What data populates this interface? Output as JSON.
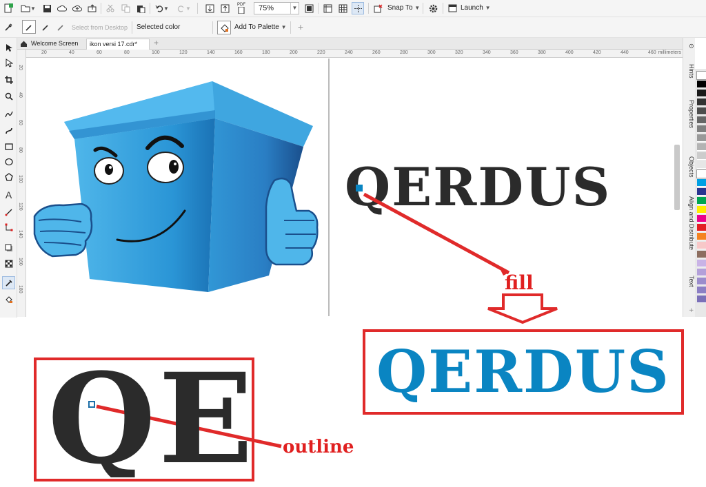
{
  "toolbar": {
    "zoom_value": "75%",
    "snap_to_label": "Snap To",
    "launch_label": "Launch",
    "pdf_label": "PDF"
  },
  "property_bar": {
    "select_from_desktop": "Select from Desktop",
    "selected_color_label": "Selected color",
    "selected_color": "#0079c1",
    "add_to_palette": "Add To Palette"
  },
  "tabs": [
    {
      "label": "Welcome Screen"
    },
    {
      "label": "ikon versi 17.cdr*"
    }
  ],
  "ruler": {
    "h_ticks": [
      "20",
      "40",
      "60",
      "80",
      "100",
      "120",
      "140",
      "160",
      "180",
      "200",
      "220",
      "240",
      "260",
      "280",
      "300",
      "320",
      "340",
      "360",
      "380",
      "400",
      "420",
      "440",
      "460"
    ],
    "units": "millimeters",
    "v_ticks": [
      "20",
      "40",
      "60",
      "80",
      "100",
      "120",
      "140",
      "160",
      "180"
    ]
  },
  "docker_tabs": [
    "Hints",
    "Properties",
    "Objects",
    "Align and Distribute",
    "Text"
  ],
  "palette_colors": [
    "#ffffff",
    "#000000",
    "#1a1a1a",
    "#333333",
    "#4d4d4d",
    "#666666",
    "#808080",
    "#999999",
    "#b3b3b3",
    "#cccccc",
    "#e6e6e6",
    "#ffffff",
    "#00a0e3",
    "#2a3590",
    "#00a651",
    "#ffed00",
    "#ec008c",
    "#e31e24",
    "#f58220",
    "#f7c8c8",
    "#8c6d5f",
    "#c9b3e6",
    "#b3a0d9",
    "#9b8ccc",
    "#8c7fc4",
    "#7b70b8"
  ],
  "canvas": {
    "main_text": "QERDUS",
    "fill_result_text": "QERDUS",
    "zoom_text": "QE",
    "fill_annotation": "fill",
    "outline_annotation": "outline"
  },
  "colors": {
    "stencil_dark": "#2b2b2b",
    "fill_blue": "#0a85c2",
    "annotation_red": "#e02a2a",
    "bin_blue": "#3aa0dd"
  }
}
